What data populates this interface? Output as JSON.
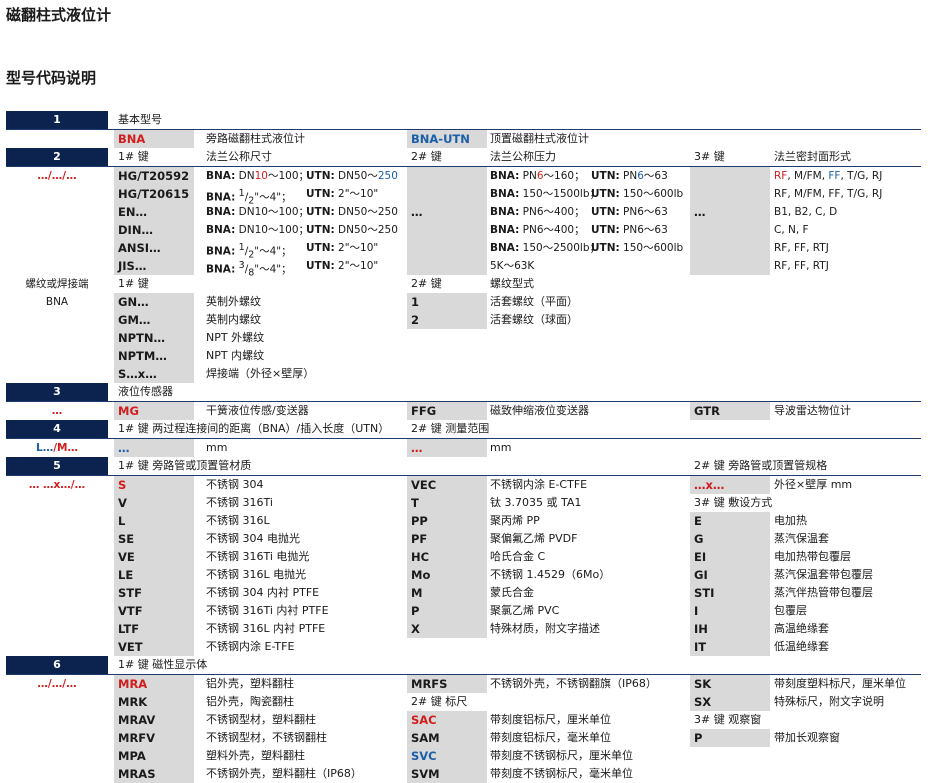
{
  "title": "磁翻柱式液位计",
  "subtitle": "型号代码说明",
  "s1": {
    "num": "1",
    "label": "基本型号",
    "a_code": "BNA",
    "a_desc": "旁路磁翻柱式液位计",
    "b_code": "BNA-UTN",
    "b_desc": "顶置磁翻柱式液位计"
  },
  "s2": {
    "num": "2",
    "key1": "1# 键",
    "key1_desc": "法兰公称尺寸",
    "key2": "2# 键",
    "key2_desc": "法兰公称压力",
    "key3": "3# 键",
    "key3_desc": "法兰密封面形式",
    "fmt": "…/…/…",
    "dots": "…",
    "bna": "BNA:",
    "utn": "UTN:",
    "semi": "；",
    "std": [
      {
        "code": "HG/T20592",
        "bna_pre": "DN",
        "bna_hi": "10",
        "bna_post": "～100",
        "utn_pre": "DN50～",
        "utn_hi": "250",
        "p_bna_pre": "PN",
        "p_bna_hi": "6",
        "p_bna_post": "～160",
        "p_utn_pre": "PN",
        "p_utn_hi": "6",
        "p_utn_post": "～63"
      },
      {
        "code": "HG/T20615",
        "bna_num": "1",
        "bna_den": "2",
        "bna_tail": "\"～4\"",
        "utn_range": "2\"～10\"",
        "p_bna": "150～1500lb",
        "p_utn": "150～600lb"
      },
      {
        "code": "EN…",
        "bna_range": "DN10～100",
        "utn_range": "DN50～250",
        "p_bna": "PN6～400",
        "p_utn": "PN6～63"
      },
      {
        "code": "DIN…",
        "bna_range": "DN10～100",
        "utn_range": "DN50～250",
        "p_bna": "PN6～400",
        "p_utn": "PN6～63"
      },
      {
        "code": "ANSI…",
        "bna_num": "1",
        "bna_den": "2",
        "bna_tail": "\"～4\"",
        "utn_range": "2\"～10\"",
        "p_bna": "150～2500lb",
        "p_utn": "150～600lb"
      },
      {
        "code": "JIS…",
        "bna_num": "3",
        "bna_den": "8",
        "bna_tail": "\"～4\"",
        "utn_range": "2\"～10\"",
        "p_plain": "5K～63K"
      }
    ],
    "seal": {
      "r1_a": "RF",
      "r1_b": ", M/FM, ",
      "r1_c": "FF",
      "r1_d": ", T/G, RJ",
      "r2": "RF, M/FM, FF, T/G, RJ",
      "r3": "B1, B2, C, D",
      "r4": "C, N, F",
      "r5": "RF, FF, RTJ",
      "r6": "RF, FF, RTJ"
    },
    "note_line1": "螺纹或焊接端",
    "note_line2": "BNA",
    "thread_key1": "1# 键",
    "thread_key2": "2# 键",
    "thread_key2_desc": "螺纹型式",
    "threads": [
      {
        "code": "GN…",
        "desc": "英制外螺纹"
      },
      {
        "code": "GM…",
        "desc": "英制内螺纹"
      },
      {
        "code": "NPTN…",
        "desc": "NPT 外螺纹"
      },
      {
        "code": "NPTM…",
        "desc": "NPT 内螺纹"
      },
      {
        "code": "S…x…",
        "desc": "焊接端（外径×壁厚）"
      }
    ],
    "thread_types": [
      {
        "code": "1",
        "desc": "活套螺纹（平面）"
      },
      {
        "code": "2",
        "desc": "活套螺纹（球面）"
      }
    ]
  },
  "s3": {
    "num": "3",
    "label": "液位传感器",
    "left": "…",
    "a_code": "MG",
    "a_desc": "干簧液位传感/变送器",
    "b_code": "FFG",
    "b_desc": "磁致伸缩液位变送器",
    "c_code": "GTR",
    "c_desc": "导波雷达物位计"
  },
  "s4": {
    "num": "4",
    "label1": "1# 键 两过程连接间的距离（BNA）/插入长度（UTN）",
    "label2": "2# 键 测量范围",
    "left_a": "L…",
    "left_b": "/M…",
    "dots": "…",
    "unit": "mm"
  },
  "s5": {
    "num": "5",
    "label1": "1# 键 旁路管或顶置管材质",
    "label2": "2# 键 旁路管或顶置管规格",
    "left": "… …x…/…",
    "spec_code": "…x…",
    "spec_desc": "外径×壁厚 mm",
    "key3": "3# 键 敷设方式",
    "mat_a": [
      {
        "code": "S",
        "desc": "不锈钢 304"
      },
      {
        "code": "V",
        "desc": "不锈钢 316Ti"
      },
      {
        "code": "L",
        "desc": "不锈钢 316L"
      },
      {
        "code": "SE",
        "desc": "不锈钢 304 电抛光"
      },
      {
        "code": "VE",
        "desc": "不锈钢 316Ti 电抛光"
      },
      {
        "code": "LE",
        "desc": "不锈钢 316L 电抛光"
      },
      {
        "code": "STF",
        "desc": "不锈钢 304 内衬 PTFE"
      },
      {
        "code": "VTF",
        "desc": "不锈钢 316Ti 内衬 PTFE"
      },
      {
        "code": "LTF",
        "desc": "不锈钢 316L 内衬 PTFE"
      },
      {
        "code": "VET",
        "desc": "不锈钢内涂 E-TFE"
      }
    ],
    "mat_b": [
      {
        "code": "VEC",
        "desc": "不锈钢内涂 E-CTFE"
      },
      {
        "code": "T",
        "desc": "钛 3.7035 或 TA1"
      },
      {
        "code": "PP",
        "desc": "聚丙烯 PP"
      },
      {
        "code": "PF",
        "desc": "聚偏氟乙烯 PVDF"
      },
      {
        "code": "HC",
        "desc": "哈氏合金 C"
      },
      {
        "code": "Mo",
        "desc": "不锈钢 1.4529（6Mo）"
      },
      {
        "code": "M",
        "desc": "蒙氏合金"
      },
      {
        "code": "P",
        "desc": "聚氯乙烯 PVC"
      },
      {
        "code": "X",
        "desc": "特殊材质，附文字描述"
      }
    ],
    "lay": [
      {
        "code": "E",
        "desc": "电加热"
      },
      {
        "code": "G",
        "desc": "蒸汽保温套"
      },
      {
        "code": "EI",
        "desc": "电加热带包覆层"
      },
      {
        "code": "GI",
        "desc": "蒸汽保温套带包覆层"
      },
      {
        "code": "STI",
        "desc": "蒸汽伴热管带包覆层"
      },
      {
        "code": "I",
        "desc": "包覆层"
      },
      {
        "code": "IH",
        "desc": "高温绝缘套"
      },
      {
        "code": "IT",
        "desc": "低温绝缘套"
      }
    ]
  },
  "s6": {
    "num": "6",
    "label": "1# 键 磁性显示体",
    "left": "…/…/…",
    "key2": "2# 键 标尺",
    "key3": "3# 键 观察窗",
    "disp_a": [
      {
        "code": "MRA",
        "desc": "铝外壳，塑料翻柱"
      },
      {
        "code": "MRK",
        "desc": "铝外壳，陶瓷翻柱"
      },
      {
        "code": "MRAV",
        "desc": "不锈钢型材，塑料翻柱"
      },
      {
        "code": "MRFV",
        "desc": "不锈钢型材，不锈钢翻柱"
      },
      {
        "code": "MPA",
        "desc": "塑料外壳，塑料翻柱"
      },
      {
        "code": "MRAS",
        "desc": "不锈钢外壳，塑料翻柱（IP68）"
      }
    ],
    "disp_b": {
      "code": "MRFS",
      "desc": "不锈钢外壳，不锈钢翻旗（IP68）"
    },
    "scales": [
      {
        "code": "SAC",
        "desc": "带刻度铝标尺，厘米单位"
      },
      {
        "code": "SAM",
        "desc": "带刻度铝标尺，毫米单位"
      },
      {
        "code": "SVC",
        "desc": "带刻度不锈钢标尺，厘米单位"
      },
      {
        "code": "SVM",
        "desc": "带刻度不锈钢标尺，毫米单位"
      }
    ],
    "disp_c": [
      {
        "code": "SK",
        "desc": "带刻度塑料标尺，厘米单位"
      },
      {
        "code": "SX",
        "desc": "特殊标尺，附文字说明"
      }
    ],
    "window": {
      "code": "P",
      "desc": "带加长观察窗"
    }
  },
  "colors": {
    "navy": "#0c2350",
    "red": "#d21d1d",
    "blue": "#1a5fa8",
    "gray": "#d9d9d9"
  }
}
